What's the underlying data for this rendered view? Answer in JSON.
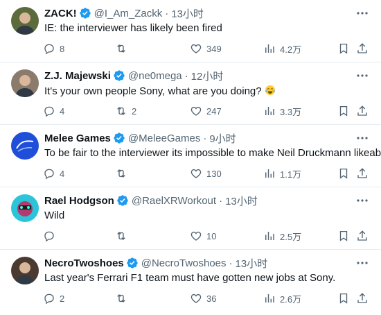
{
  "tweets": [
    {
      "name": "ZACK!",
      "handle": "@I_Am_Zackk",
      "time": "13小时",
      "text": "IE: the interviewer has likely been fired",
      "emoji": "",
      "replies": "8",
      "retweets": "",
      "likes": "349",
      "views": "4.2万",
      "avatar_icon": "avatar-photo",
      "avatar_color": "#5b6b3a"
    },
    {
      "name": "Z.J. Majewski",
      "handle": "@ne0mega",
      "time": "12小时",
      "text": "It's your own people Sony, what are you doing?",
      "emoji": "face-with-tears-of-joy-emoji",
      "replies": "4",
      "retweets": "2",
      "likes": "247",
      "views": "3.3万",
      "avatar_icon": "avatar-photo",
      "avatar_color": "#8a7b6c"
    },
    {
      "name": "Melee Games",
      "handle": "@MeleeGames",
      "time": "9小时",
      "text": "To be fair to the interviewer its impossible to make Neil Druckmann likeable",
      "emoji": "",
      "replies": "4",
      "retweets": "",
      "likes": "130",
      "views": "1.1万",
      "avatar_icon": "melee-games-logo",
      "avatar_color": "#1f4fd8"
    },
    {
      "name": "Rael Hodgson",
      "handle": "@RaelXRWorkout",
      "time": "13小时",
      "text": "Wild",
      "emoji": "",
      "replies": "",
      "retweets": "",
      "likes": "10",
      "views": "2.5万",
      "avatar_icon": "avatar-character",
      "avatar_color": "#2cc4d9"
    },
    {
      "name": "NecroTwoshoes",
      "handle": "@NecroTwoshoes",
      "time": "13小时",
      "text": "Last year's Ferrari F1 team must have gotten new jobs at Sony.",
      "emoji": "",
      "replies": "2",
      "retweets": "",
      "likes": "36",
      "views": "2.6万",
      "avatar_icon": "avatar-photo",
      "avatar_color": "#4a3a30"
    }
  ],
  "colors": {
    "text": "#0f1419",
    "secondary": "#536471",
    "verified": "#1d9bf0",
    "divider": "#e6ecf0"
  }
}
